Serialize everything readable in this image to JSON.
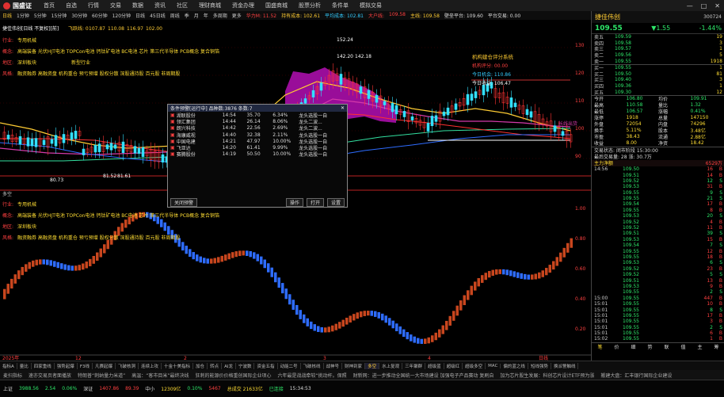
{
  "menubar": {
    "logo": "国盛证",
    "items": [
      "首页",
      "自选",
      "行情",
      "交易",
      "数据",
      "资讯",
      "社区",
      "理财商城",
      "资金办理",
      "国盛商城",
      "股票分析",
      "条件单",
      "模拟交易"
    ],
    "window_buttons": [
      "—",
      "□",
      "✕"
    ]
  },
  "toolbar": {
    "periods": [
      "日线",
      "1分钟",
      "5分钟",
      "15分钟",
      "30分钟",
      "60分钟",
      "120分钟",
      "日线",
      "45日线",
      "周线",
      "季",
      "月",
      "年",
      "多周期",
      "更多"
    ],
    "indicators": [
      {
        "text": "华力M: 11.52",
        "color": "red"
      },
      {
        "text": "持有成本: 102.61",
        "color": "yel"
      },
      {
        "text": "平均成本: 102.81",
        "color": "cy"
      },
      {
        "text": "大户线:",
        "color": "red"
      },
      {
        "text": "109.58",
        "color": "red"
      },
      {
        "text": "主线: 109.58",
        "color": "yel"
      },
      {
        "text": "壁垒平台: 109.60",
        "color": "w"
      },
      {
        "text": "平台交易: 0.00",
        "color": "w"
      }
    ],
    "right_buttons": [
      "复权",
      "除权",
      "前复",
      "F10",
      "扩展"
    ]
  },
  "chart": {
    "stock_line": "捷佳伟创[日线 不复权][前]",
    "hl_prefix": "飞跃线: 0 ",
    "hl_vals": [
      "107.87",
      "110.08",
      "116.97",
      "102.00"
    ],
    "upper_labels": [
      {
        "k": "行业:",
        "v": "专用机械"
      },
      {
        "k": "概念:",
        "v": "高端装备 光伏HJT电池 TOPCon电池 钙钛矿电池 BC电池 芯片 第三代半导体 PCB概念 复合铜箔"
      },
      {
        "k": "地区:",
        "v": "深圳板块",
        "extra": "新型行业"
      },
      {
        "k": "风格:",
        "v": "融资融券 高融资盘 机构重仓 预亏预增 股权分散 深股通持股 百元股 非周期股"
      }
    ],
    "lower_labels": [
      {
        "k": "行业:",
        "v": "专用机械"
      },
      {
        "k": "概念:",
        "v": "高端装备 光伏HJT电池 TOPCon电池 钙钛矿电池 BC电池 芯片 第三代半导体 PCB概念 复合铜箔"
      },
      {
        "k": "地区:",
        "v": "深圳板块"
      },
      {
        "k": "风格:",
        "v": "融资融券 高融资盘 机构重仓 预亏预增 股权分散 深股通持股 百元股 非周期股"
      }
    ],
    "price_marks": [
      "152.24",
      "142.20",
      "142.18",
      "81.52",
      "81.61",
      "80.73"
    ],
    "annot_title": "机构建仓评分系统",
    "annot_lines": [
      "机构评分: 00.00",
      "今日机会: 110.86",
      "今日收益: 106.47"
    ],
    "side_label": "长线出货",
    "lower_title": "多空",
    "upper_axis": [
      "130",
      "120",
      "110",
      "100",
      "90"
    ],
    "lower_axis": [
      "1.00",
      "0.80",
      "0.60",
      "0.40",
      "0.20"
    ],
    "date_labels": [
      "2025年",
      "12",
      "2",
      "3",
      "4",
      "日线"
    ]
  },
  "popup": {
    "title": "条件预警[运行中] 品种数:3876 条数:7",
    "rows": [
      {
        "name": "湖联股份",
        "time": "14:54",
        "price": "35.70",
        "pct": "6.34%",
        "desc": "龙头选股一自"
      },
      {
        "name": "领汇集团",
        "time": "14:44",
        "price": "26.14",
        "pct": "8.06%",
        "desc": "龙头二波..."
      },
      {
        "name": "朗兴科技",
        "time": "14:42",
        "price": "22.56",
        "pct": "2.69%",
        "desc": "龙头二波..."
      },
      {
        "name": "海康威视",
        "time": "14:40",
        "price": "32.38",
        "pct": "2.11%",
        "desc": "龙头选股一自"
      },
      {
        "name": "中国电建",
        "time": "14:21",
        "price": "47.97",
        "pct": "10.00%",
        "desc": "龙头选股一自"
      },
      {
        "name": "飞亚达",
        "time": "14:20",
        "price": "61.41",
        "pct": "9.99%",
        "desc": "龙头选股一自"
      },
      {
        "name": "赛腾股份",
        "time": "14:19",
        "price": "50.50",
        "pct": "10.00%",
        "desc": "龙头选股一自"
      }
    ],
    "buttons": [
      "关闭预警",
      "操作",
      "打开",
      "设置"
    ]
  },
  "right": {
    "name": "捷佳伟创",
    "code": "300724",
    "price": "109.55",
    "change": "▼1.55",
    "pct": "-1.44%",
    "sells": [
      {
        "l": "卖五",
        "p": "109.59",
        "v": "19"
      },
      {
        "l": "卖四",
        "p": "109.58",
        "v": "3"
      },
      {
        "l": "卖三",
        "p": "109.57",
        "v": "1"
      },
      {
        "l": "卖二",
        "p": "109.56",
        "v": "5"
      },
      {
        "l": "卖一",
        "p": "109.55",
        "v": "1918"
      }
    ],
    "buys": [
      {
        "l": "买一",
        "p": "109.55",
        "v": "1"
      },
      {
        "l": "买二",
        "p": "109.50",
        "v": "81"
      },
      {
        "l": "买三",
        "p": "109.40",
        "v": "3"
      },
      {
        "l": "买四",
        "p": "109.36",
        "v": "1"
      },
      {
        "l": "买五",
        "p": "109.30",
        "v": "12"
      }
    ],
    "stats": [
      [
        "今开",
        "106.80",
        "均价",
        "109.91"
      ],
      [
        "最高",
        "110.58",
        "量比",
        "1.32"
      ],
      [
        "最低",
        "106.57",
        "涨幅",
        "0.41%"
      ],
      [
        "涨停",
        "1918",
        "总量",
        "147150"
      ],
      [
        "外盘",
        "72054",
        "内盘",
        "74296"
      ],
      [
        "换手",
        "5.11%",
        "股本",
        "3.48亿"
      ],
      [
        "市盈",
        "38.43",
        "流通",
        "2.88亿"
      ],
      [
        "收益",
        "8.00",
        "净资",
        "18.42"
      ]
    ],
    "status_line1": "交易状态: 闭市阶段 15:30:00",
    "status_line2": "最后交易量: 28  涨: 30.7万",
    "flow_label": "主力净额",
    "flow_value": "6529万",
    "ticks": [
      {
        "t": "14:56",
        "p": "109.50",
        "v": "16",
        "f": "B"
      },
      {
        "t": "",
        "p": "109.51",
        "v": "14",
        "f": "B"
      },
      {
        "t": "",
        "p": "109.52",
        "v": "12",
        "f": "S"
      },
      {
        "t": "",
        "p": "109.53",
        "v": "31",
        "f": "B"
      },
      {
        "t": "",
        "p": "109.55",
        "v": "9",
        "f": "S"
      },
      {
        "t": "",
        "p": "109.55",
        "v": "21",
        "f": "S"
      },
      {
        "t": "",
        "p": "109.54",
        "v": "17",
        "f": "B"
      },
      {
        "t": "",
        "p": "109.55",
        "v": "8",
        "f": "B"
      },
      {
        "t": "",
        "p": "109.53",
        "v": "20",
        "f": "S"
      },
      {
        "t": "",
        "p": "109.52",
        "v": "4",
        "f": "B"
      },
      {
        "t": "",
        "p": "109.52",
        "v": "11",
        "f": "B"
      },
      {
        "t": "",
        "p": "109.51",
        "v": "39",
        "f": "S"
      },
      {
        "t": "",
        "p": "109.53",
        "v": "15",
        "f": "B"
      },
      {
        "t": "",
        "p": "109.54",
        "v": "7",
        "f": "S"
      },
      {
        "t": "",
        "p": "109.55",
        "v": "12",
        "f": "B"
      },
      {
        "t": "",
        "p": "109.55",
        "v": "18",
        "f": "B"
      },
      {
        "t": "",
        "p": "109.53",
        "v": "6",
        "f": "S"
      },
      {
        "t": "",
        "p": "109.52",
        "v": "23",
        "f": "B"
      },
      {
        "t": "",
        "p": "109.52",
        "v": "5",
        "f": "S"
      },
      {
        "t": "",
        "p": "109.51",
        "v": "13",
        "f": "B"
      },
      {
        "t": "",
        "p": "109.53",
        "v": "9",
        "f": "B"
      },
      {
        "t": "",
        "p": "109.55",
        "v": "2",
        "f": "S"
      },
      {
        "t": "15:00",
        "p": "109.55",
        "v": "447",
        "f": "B"
      },
      {
        "t": "15:01",
        "p": "109.55",
        "v": "10",
        "f": "B"
      },
      {
        "t": "15:01",
        "p": "109.55",
        "v": "8",
        "f": "S"
      },
      {
        "t": "15:01",
        "p": "109.55",
        "v": "17",
        "f": "B"
      },
      {
        "t": "15:01",
        "p": "109.55",
        "v": "3",
        "f": "B"
      },
      {
        "t": "15:01",
        "p": "109.55",
        "v": "2",
        "f": "S"
      },
      {
        "t": "15:01",
        "p": "109.55",
        "v": "6",
        "f": "B"
      },
      {
        "t": "15:02",
        "p": "109.55",
        "v": "1",
        "f": "B"
      }
    ],
    "tabs": [
      "笔",
      "价",
      "细",
      "势",
      "联",
      "值",
      "主",
      "筹"
    ]
  },
  "bottomtabs": [
    "指标A",
    "量比",
    "四家重线",
    "强势起爆",
    "F3线",
    "凡赛起爆",
    "飞破核洞",
    "连续上攻",
    "十金十美指标",
    "加仓",
    "转点",
    "AI龙",
    "宁波数",
    "资金五指",
    "动能二号",
    "飞破核线",
    "战神号",
    "财神到家",
    "多空",
    "水上复观",
    "三年聚群",
    "超级蓝",
    "超级红",
    "超级多空",
    "MAC",
    "偏的蓝之线",
    "短线强势",
    "换派警触线"
  ],
  "news": [
    "麦扫指标",
    "速亦交易页者面播放",
    "特朗普“刺纳量力米道”",
    "高温：“客市目米”最终决线",
    "狂刺的能源价价格重创国际企业项心",
    "六年最是战战牵较“挑动杆。保照",
    "财新网：进一步推动全国统一大市场建设 加强电子产品赛动 复刷自",
    "加为芯片股生发展：科创芯片设计ETF预为涨",
    "搬建大盘：汇丰银行国际企业建设"
  ],
  "status": [
    {
      "t": "上证",
      "c": "w"
    },
    {
      "t": "3988.56",
      "c": "g"
    },
    {
      "t": "2.54",
      "c": "g"
    },
    {
      "t": "0.06%",
      "c": "g"
    },
    {
      "t": "深证",
      "c": "w"
    },
    {
      "t": "1407.86",
      "c": "r"
    },
    {
      "t": "89.39",
      "c": "r"
    },
    {
      "t": "中小",
      "c": "w"
    },
    {
      "t": "12309亿",
      "c": "y"
    },
    {
      "t": "0.10%",
      "c": "g"
    },
    {
      "t": "5467",
      "c": "r"
    },
    {
      "t": "总成交 21633亿",
      "c": "y"
    },
    {
      "t": "已连接",
      "c": "g"
    },
    {
      "t": "15:34:53",
      "c": "w"
    }
  ]
}
